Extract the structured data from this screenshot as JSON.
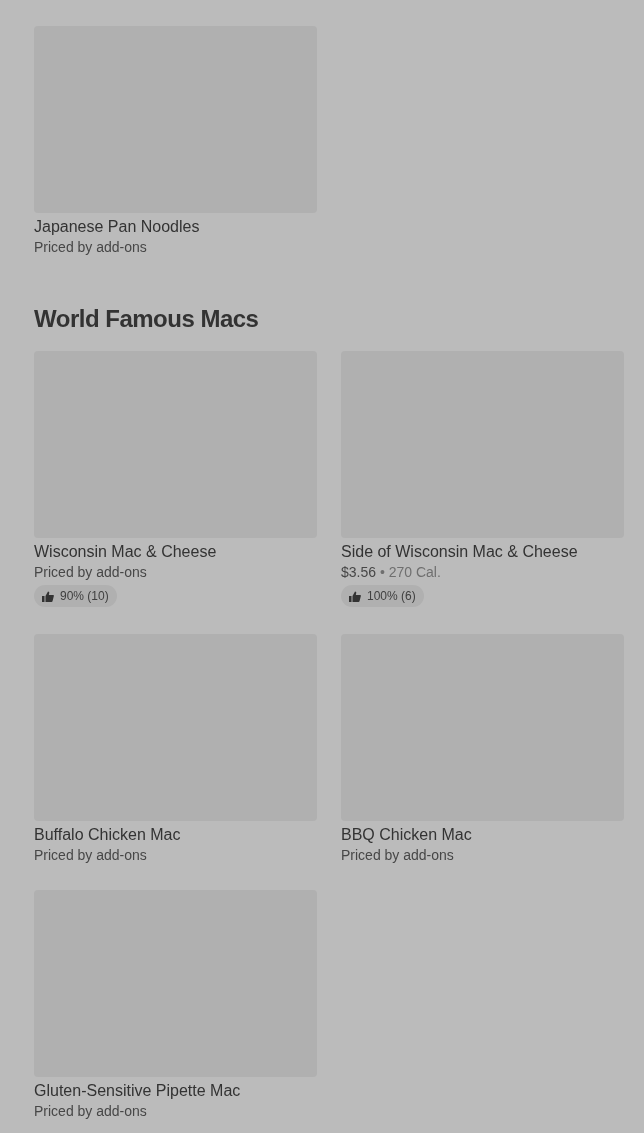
{
  "sections": [
    {
      "items": [
        {
          "name": "Japanese Pan Noodles",
          "price": "Priced by add-ons"
        }
      ]
    },
    {
      "title": "World Famous Macs",
      "items": [
        {
          "name": "Wisconsin Mac & Cheese",
          "price": "Priced by add-ons",
          "rating": "90% (10)"
        },
        {
          "name": "Side of Wisconsin Mac & Cheese",
          "price": "$3.56",
          "calories": "• 270 Cal.",
          "rating": "100% (6)"
        },
        {
          "name": "Buffalo Chicken Mac",
          "price": "Priced by add-ons"
        },
        {
          "name": "BBQ Chicken Mac",
          "price": "Priced by add-ons"
        },
        {
          "name": "Gluten-Sensitive Pipette Mac",
          "price": "Priced by add-ons"
        }
      ]
    }
  ]
}
